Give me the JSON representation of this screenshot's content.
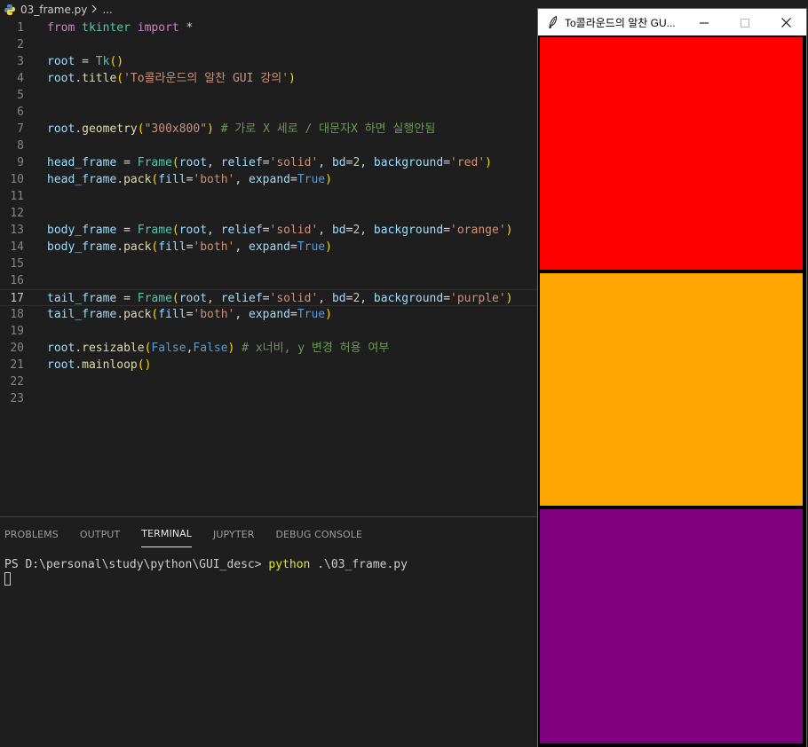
{
  "breadcrumb": {
    "file": "03_frame.py",
    "more": "..."
  },
  "editor": {
    "lines": [
      {
        "n": "1"
      },
      {
        "n": "2"
      },
      {
        "n": "3"
      },
      {
        "n": "4"
      },
      {
        "n": "5"
      },
      {
        "n": "6"
      },
      {
        "n": "7"
      },
      {
        "n": "8"
      },
      {
        "n": "9"
      },
      {
        "n": "10"
      },
      {
        "n": "11"
      },
      {
        "n": "12"
      },
      {
        "n": "13"
      },
      {
        "n": "14"
      },
      {
        "n": "15"
      },
      {
        "n": "16"
      },
      {
        "n": "17"
      },
      {
        "n": "18"
      },
      {
        "n": "19"
      },
      {
        "n": "20"
      },
      {
        "n": "21"
      },
      {
        "n": "22"
      },
      {
        "n": "23"
      }
    ],
    "tokens": {
      "l1": [
        "from",
        " tkinter ",
        "import",
        " *"
      ],
      "l3": [
        "root",
        " = ",
        "Tk",
        "()"
      ],
      "l4": [
        "root",
        ".",
        "title",
        "(",
        "'To콜라운드의 알찬 GUI 강의'",
        ")"
      ],
      "l7": [
        "root",
        ".",
        "geometry",
        "(",
        "\"300x800\"",
        ")",
        " # 가로 X 세로 / 대문자X 하면 실행안됨"
      ],
      "l9": [
        "head_frame",
        " = ",
        "Frame",
        "(",
        "root",
        ", ",
        "relief",
        "=",
        "'solid'",
        ", ",
        "bd",
        "=",
        "2",
        ", ",
        "background",
        "=",
        "'red'",
        ")"
      ],
      "l10": [
        "head_frame",
        ".",
        "pack",
        "(",
        "fill",
        "=",
        "'both'",
        ", ",
        "expand",
        "=",
        "True",
        ")"
      ],
      "l13": [
        "body_frame",
        " = ",
        "Frame",
        "(",
        "root",
        ", ",
        "relief",
        "=",
        "'solid'",
        ", ",
        "bd",
        "=",
        "2",
        ", ",
        "background",
        "=",
        "'orange'",
        ")"
      ],
      "l14": [
        "body_frame",
        ".",
        "pack",
        "(",
        "fill",
        "=",
        "'both'",
        ", ",
        "expand",
        "=",
        "True",
        ")"
      ],
      "l17": [
        "tail_frame",
        " = ",
        "Frame",
        "(",
        "root",
        ", ",
        "relief",
        "=",
        "'solid'",
        ", ",
        "bd",
        "=",
        "2",
        ", ",
        "background",
        "=",
        "'purple'",
        ")"
      ],
      "l18": [
        "tail_frame",
        ".",
        "pack",
        "(",
        "fill",
        "=",
        "'both'",
        ", ",
        "expand",
        "=",
        "True",
        ")"
      ],
      "l20": [
        "root",
        ".",
        "resizable",
        "(",
        "False",
        ",",
        "False",
        ")",
        " # x너비, y 변경 허용 여부"
      ],
      "l21": [
        "root",
        ".",
        "mainloop",
        "()"
      ]
    }
  },
  "panel": {
    "tabs": [
      "PROBLEMS",
      "OUTPUT",
      "TERMINAL",
      "JUPYTER",
      "DEBUG CONSOLE"
    ],
    "active_tab": "TERMINAL",
    "terminal": {
      "prompt": "PS D:\\personal\\study\\python\\GUI_desc> ",
      "command": "python",
      "args": " .\\03_frame.py"
    }
  },
  "tk_window": {
    "title": "To콜라운드의 알찬 GU...",
    "frames": [
      {
        "name": "head",
        "color": "#ff0000"
      },
      {
        "name": "body",
        "color": "#ffa500"
      },
      {
        "name": "tail",
        "color": "#800080"
      }
    ]
  },
  "icons": {
    "breadcrumb_file": "python-file-icon",
    "breadcrumb_sep": "chevron-right-icon",
    "tk_app": "feather-icon",
    "minimize": "minimize-icon",
    "maximize": "maximize-icon",
    "close": "close-icon"
  }
}
